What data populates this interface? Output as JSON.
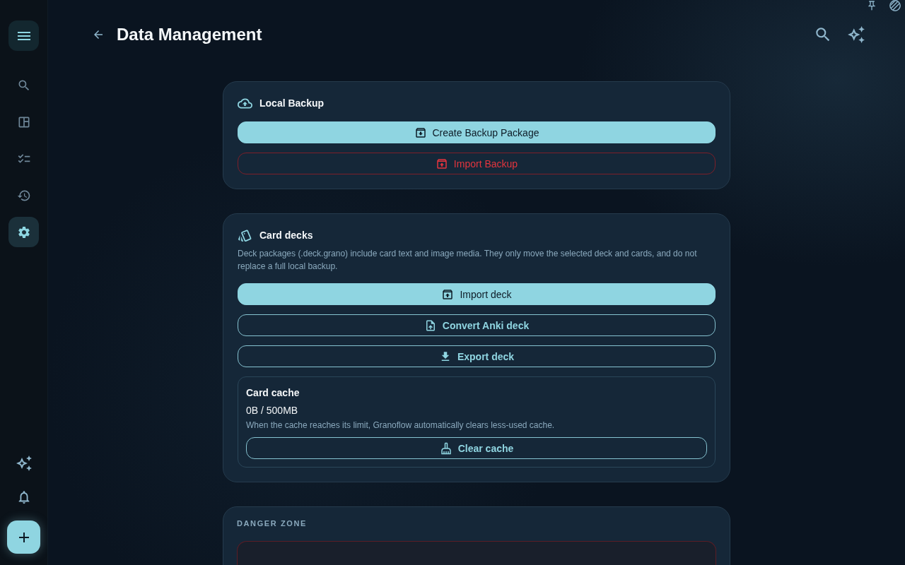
{
  "sidebar": {
    "nav_items": [
      {
        "kind": "search",
        "selected": false
      },
      {
        "kind": "dashboard",
        "selected": false
      },
      {
        "kind": "checklist",
        "selected": false
      },
      {
        "kind": "history",
        "selected": false
      },
      {
        "kind": "settings",
        "selected": true
      }
    ]
  },
  "header": {
    "title": "Data Management"
  },
  "local_backup": {
    "title": "Local Backup",
    "buttons": [
      {
        "kind": "primary",
        "label": "Create Backup Package"
      },
      {
        "kind": "danger",
        "label": "Import Backup"
      }
    ]
  },
  "card_decks": {
    "title": "Card decks",
    "description": "Deck packages (.deck.grano) include card text and image media. They only move the selected deck and cards, and do not replace a full local backup.",
    "buttons": [
      {
        "kind": "primary",
        "label": "Import deck"
      },
      {
        "kind": "outline",
        "label": "Convert Anki deck"
      },
      {
        "kind": "outline",
        "label": "Export deck"
      }
    ],
    "cache": {
      "title": "Card cache",
      "usage": "0B / 500MB",
      "note": "When the cache reaches its limit, Granoflow automatically clears less-used cache.",
      "button": "Clear cache"
    }
  },
  "danger_zone": {
    "title": "DANGER ZONE"
  }
}
